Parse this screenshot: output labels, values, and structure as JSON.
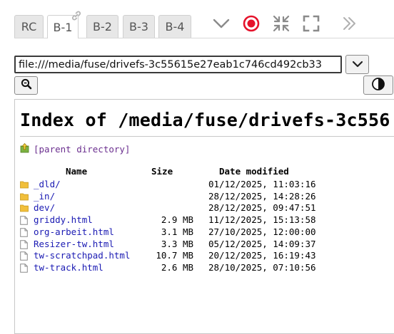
{
  "tabs": [
    {
      "label": "RC",
      "active": false
    },
    {
      "label": "B-1",
      "active": true
    },
    {
      "label": "B-2",
      "active": false
    },
    {
      "label": "B-3",
      "active": false
    },
    {
      "label": "B-4",
      "active": false
    }
  ],
  "toolbar_icons": [
    "chevron-down-icon",
    "record-icon",
    "shrink-icon",
    "fullscreen-icon",
    "double-chevron-right-icon",
    "link-icon"
  ],
  "colors": {
    "record": "#e5122b",
    "folder": "#f1bf3b",
    "link": "#1a1ab3",
    "visited": "#6b2f8f"
  },
  "address": {
    "value": "file:///media/fuse/drivefs-3c55615e27eab1c746cd492cb33"
  },
  "page": {
    "title": "Index of /media/fuse/drivefs-3c556",
    "parent_link": "[parent directory]",
    "headers": {
      "name": "Name",
      "size": "Size",
      "modified": "Date modified"
    },
    "entries": [
      {
        "name": "_dld/",
        "type": "folder",
        "size": "",
        "modified": "01/12/2025, 11:03:16"
      },
      {
        "name": "_in/",
        "type": "folder",
        "size": "",
        "modified": "28/12/2025, 14:28:26"
      },
      {
        "name": "dev/",
        "type": "folder",
        "size": "",
        "modified": "28/12/2025, 09:47:51"
      },
      {
        "name": "griddy.html",
        "type": "file",
        "size": "2.9 MB",
        "modified": "11/12/2025, 15:13:58"
      },
      {
        "name": "org-arbeit.html",
        "type": "file",
        "size": "3.1 MB",
        "modified": "27/10/2025, 12:00:00"
      },
      {
        "name": "Resizer-tw.html",
        "type": "file",
        "size": "3.3 MB",
        "modified": "05/12/2025, 14:09:37"
      },
      {
        "name": "tw-scratchpad.html",
        "type": "file",
        "size": "10.7 MB",
        "modified": "20/12/2025, 16:19:43"
      },
      {
        "name": "tw-track.html",
        "type": "file",
        "size": "2.6 MB",
        "modified": "28/10/2025, 07:10:56"
      }
    ]
  }
}
